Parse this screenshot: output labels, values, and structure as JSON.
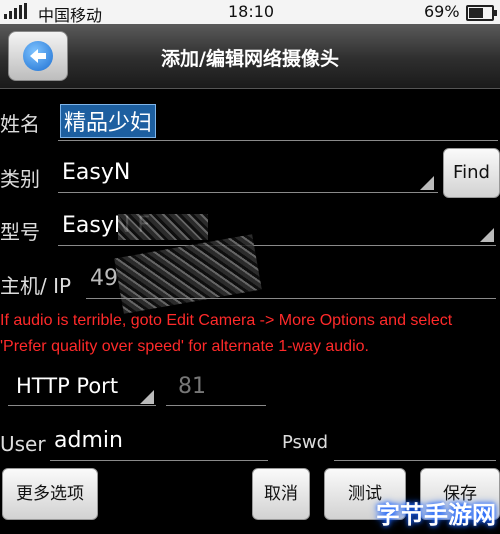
{
  "status_bar": {
    "carrier": "中国移动",
    "time": "18:10",
    "battery": "69%",
    "battery_level": 0.69
  },
  "header": {
    "title": "添加/编辑网络摄像头",
    "back_icon": "back-arrow-icon"
  },
  "form": {
    "name_label": "姓名",
    "name_value": "精品少妇",
    "category_label": "类别",
    "category_value": "EasyN",
    "find_label": "Find",
    "model_label": "型号",
    "model_value": "EasyN F",
    "host_label": "主机/ IP",
    "host_value": "49",
    "warning": "If audio is terrible, goto Edit Camera -> More Options and select 'Prefer quality over speed' for alternate 1-way audio.",
    "port_type": "HTTP Port",
    "port_value": "81",
    "user_label": "User",
    "user_value": "admin",
    "pswd_label": "Pswd",
    "pswd_value": ""
  },
  "buttons": {
    "more_options": "更多选项",
    "cancel": "取消",
    "test": "测试",
    "save": "保存"
  },
  "watermark": "字节手游网",
  "colors": {
    "warning": "#ff2a2a",
    "selection": "#1d5fa0",
    "back_icon": "#1d6fd1"
  }
}
